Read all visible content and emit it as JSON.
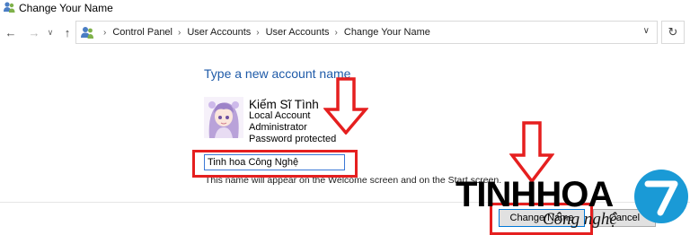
{
  "window": {
    "title": "Change Your Name"
  },
  "breadcrumb": {
    "items": [
      "Control Panel",
      "User Accounts",
      "User Accounts",
      "Change Your Name"
    ]
  },
  "content": {
    "heading": "Type a new account name",
    "user_name": "Kiếm Sĩ Tình",
    "account_type": "Local Account",
    "role": "Administrator",
    "password_status": "Password protected",
    "name_input_value": "Tinh hoa Công Nghệ",
    "hint": "This name will appear on the Welcome screen and on the Start screen."
  },
  "buttons": {
    "change_name": "Change Name",
    "cancel": "Cancel"
  },
  "watermark": {
    "brand": "TINHHOA",
    "tagline": "Công nghệ",
    "badge": "7"
  },
  "icons": {
    "title": "users-icon",
    "back": "arrow-left-icon",
    "forward": "arrow-right-icon",
    "up": "arrow-up-icon",
    "refresh": "refresh-icon"
  },
  "colors": {
    "heading": "#1e5aa8",
    "annotation": "#e51f1f",
    "badge": "#1a9ad6",
    "input_border": "#3b78d6"
  }
}
